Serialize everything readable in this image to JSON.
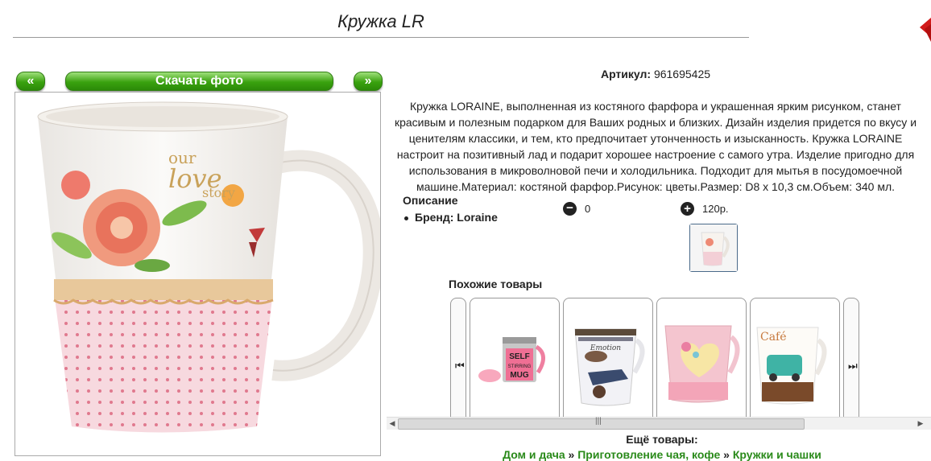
{
  "page": {
    "title": "Кружка LR"
  },
  "toolbar": {
    "prev_label": "«",
    "next_label": "»",
    "download_label": "Скачать фото"
  },
  "product": {
    "article_label": "Артикул:",
    "article_value": "961695425",
    "description": "Кружка LORAINE, выполненная из костяного фарфора и украшенная ярким рисунком, станет красивым и полезным подарком для Ваших родных и близких. Дизайн изделия придется по вкусу и ценителям классики, и тем, кто предпочитает утонченность и изысканность. Кружка LORAINE настроит на позитивный лад и подарит хорошее настроение с самого утра. Изделие пригодно для использования в микроволновой печи и холодильника. Подходит для мытья в посудомоечной машине.Материал: костяной фарфор.Рисунок: цветы.Размер: D8 x 10,3 см.Объем: 340 мл.",
    "description_heading": "Описание",
    "brand": "Бренд: Loraine",
    "quantity": "0",
    "price": "120р."
  },
  "similar": {
    "title": "Похожие товары",
    "items": [
      {
        "name": "self-stirring-mug",
        "text": "SELF STIRRING MUG"
      },
      {
        "name": "car-mug",
        "text": "Emotion"
      },
      {
        "name": "heart-mug",
        "text": ""
      },
      {
        "name": "cafe-mug",
        "text": "Café"
      }
    ]
  },
  "more": {
    "title": "Ещё товары:",
    "crumbs": [
      "Дом и дача",
      "Приготовление чая, кофе",
      "Кружки и чашки"
    ],
    "separator": " » "
  },
  "colors": {
    "button_green": "#3aa20f",
    "link_green": "#2a8a1a",
    "corner_red": "#d11a1a"
  }
}
